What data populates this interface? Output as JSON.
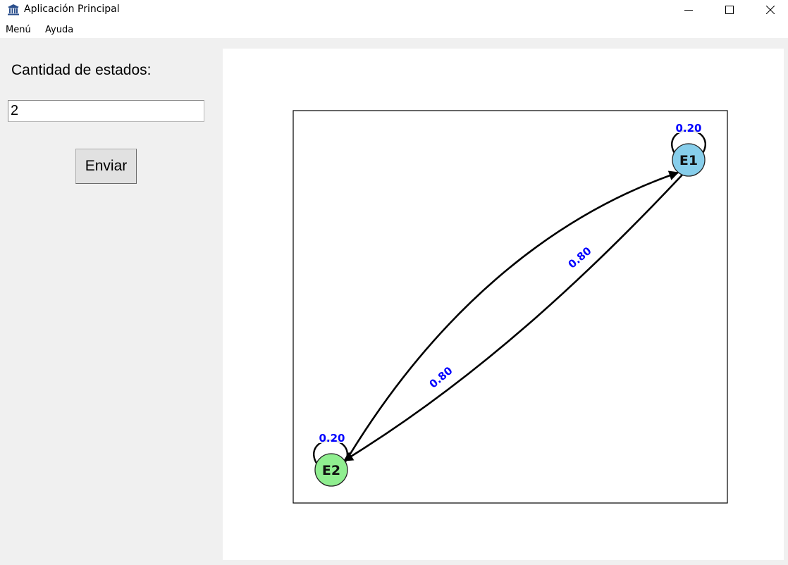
{
  "window": {
    "title": "Aplicación Principal",
    "icon": "bank-building-icon",
    "controls": [
      "minimize-icon",
      "maximize-icon",
      "close-icon"
    ]
  },
  "menubar": {
    "items": [
      "Menú",
      "Ayuda"
    ]
  },
  "form": {
    "count_label": "Cantidad de estados:",
    "count_value": "2",
    "submit_label": "Enviar"
  },
  "graph": {
    "nodes": [
      {
        "id": "E1",
        "label": "E1",
        "color": "#87ceeb"
      },
      {
        "id": "E2",
        "label": "E2",
        "color": "#90ee90"
      }
    ],
    "edges": [
      {
        "from": "E1",
        "to": "E1",
        "label": "0.20"
      },
      {
        "from": "E2",
        "to": "E2",
        "label": "0.20"
      },
      {
        "from": "E2",
        "to": "E1",
        "label": "0.80"
      },
      {
        "from": "E1",
        "to": "E2",
        "label": "0.80"
      }
    ],
    "edge_label_color": "#0000ff"
  }
}
